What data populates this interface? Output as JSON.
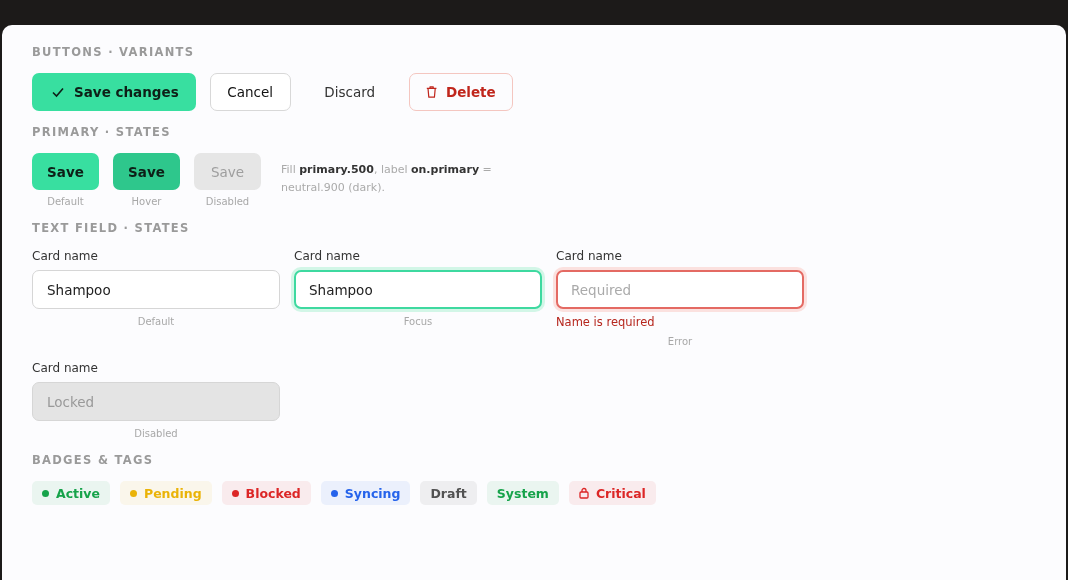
{
  "sections": [
    {
      "kind": "buttons",
      "title": "BUTTONS · VARIANTS",
      "buttons": [
        {
          "kind": "primary",
          "label": "Save changes"
        },
        {
          "kind": "secondary",
          "label": "Cancel"
        },
        {
          "kind": "ghost",
          "label": "Discard"
        },
        {
          "kind": "danger",
          "label": "Delete"
        }
      ]
    },
    {
      "kind": "states",
      "title": "PRIMARY · STATES",
      "note": "Fill **primary.500**, label **on.primary** = neutral.900 (dark).",
      "buttons": [
        {
          "label": "Save",
          "kind": "default",
          "caption": "Default"
        },
        {
          "label": "Save",
          "kind": "hover",
          "caption": "Hover"
        },
        {
          "label": "Save",
          "kind": "disabled",
          "caption": "Disabled"
        }
      ]
    },
    {
      "kind": "fields",
      "title": "TEXT FIELD · STATES",
      "fields": [
        {
          "label": "Card name",
          "value": "Shampoo",
          "kind": "default",
          "caption": "Default"
        },
        {
          "label": "Card name",
          "value": "Shampoo",
          "kind": "focus",
          "caption": "Focus"
        },
        {
          "label": "Card name",
          "placeholder": "Required",
          "kind": "error",
          "error": "Name is required",
          "caption": "Error"
        },
        {
          "label": "Card name",
          "value": "Locked",
          "kind": "disabled",
          "caption": "Disabled"
        }
      ]
    },
    {
      "kind": "badges",
      "title": "BADGES & TAGS",
      "badges": [
        {
          "kind": "dot",
          "label": "Active",
          "color": "#16a34a"
        },
        {
          "kind": "dot",
          "label": "Pending",
          "color": "#eab308"
        },
        {
          "kind": "dot",
          "label": "Blocked",
          "color": "#dc2626"
        },
        {
          "kind": "dot",
          "label": "Syncing",
          "color": "#2563eb"
        },
        {
          "kind": "plain",
          "label": "Draft",
          "color": "#525252"
        },
        {
          "kind": "plain",
          "label": "System",
          "color": "#16a34a"
        },
        {
          "kind": "lock",
          "label": "Critical",
          "color": "#dc2626"
        }
      ]
    }
  ]
}
